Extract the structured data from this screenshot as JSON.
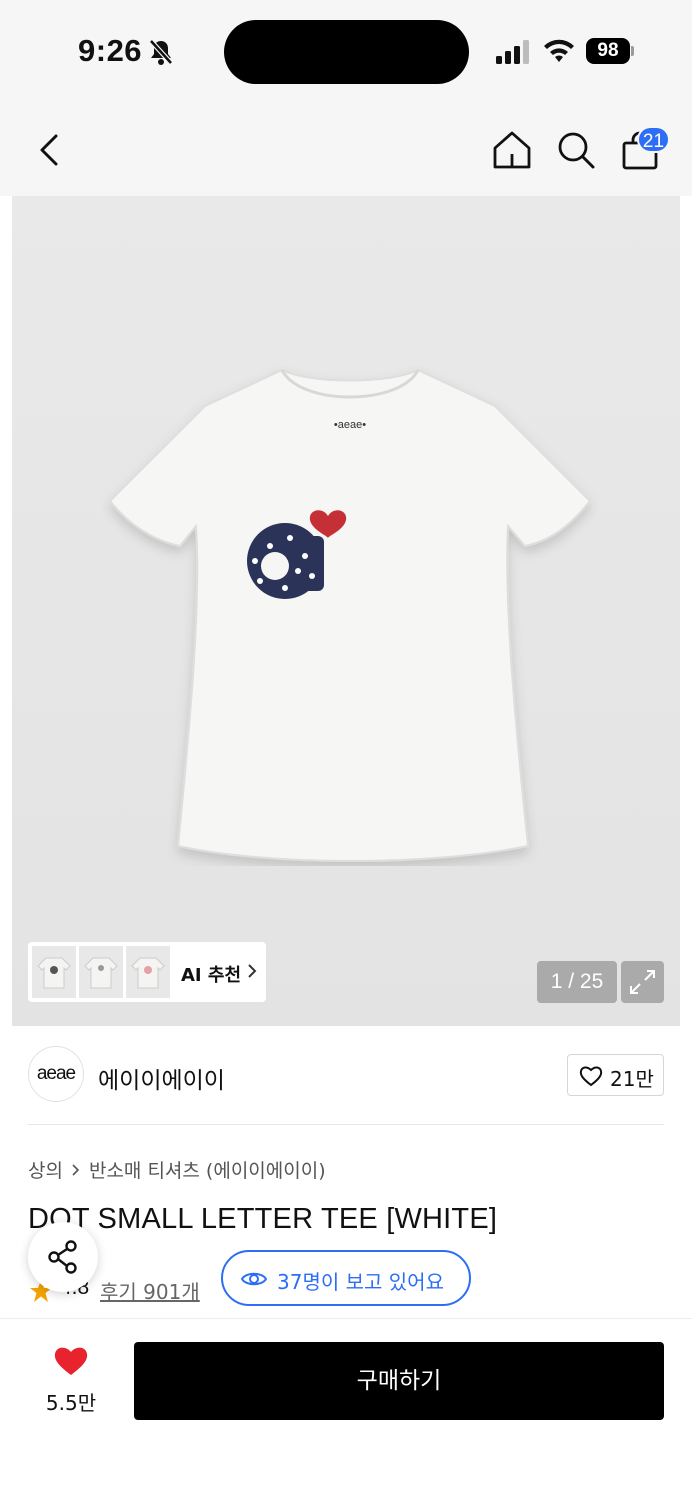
{
  "status_bar": {
    "time": "9:26",
    "battery": "98"
  },
  "header": {
    "cart_count": "21",
    "icons": [
      "back-icon",
      "home-icon",
      "search-icon",
      "shopping-bag-icon"
    ]
  },
  "gallery": {
    "ai_label": "AI 추천",
    "counter": "1 / 25",
    "thumbnails": [
      "thumb-1",
      "thumb-2",
      "thumb-3"
    ]
  },
  "brand": {
    "logo_text": "aeae",
    "name": "에이이에이이",
    "like_count": "21만"
  },
  "product": {
    "breadcrumb": [
      "상의",
      "반소매 티셔츠 (에이이에이이)"
    ],
    "title": "DOT SMALL LETTER TEE [WHITE]",
    "rating": "4.8",
    "reviews": "후기 901개",
    "viewers": "37명이 보고 있어요"
  },
  "bottom_bar": {
    "wish_count": "5.5만",
    "buy_label": "구매하기"
  },
  "colors": {
    "accent": "#2d6ef6",
    "heart": "#e8232d",
    "star": "#f5a300",
    "buy_button": "#000000"
  }
}
